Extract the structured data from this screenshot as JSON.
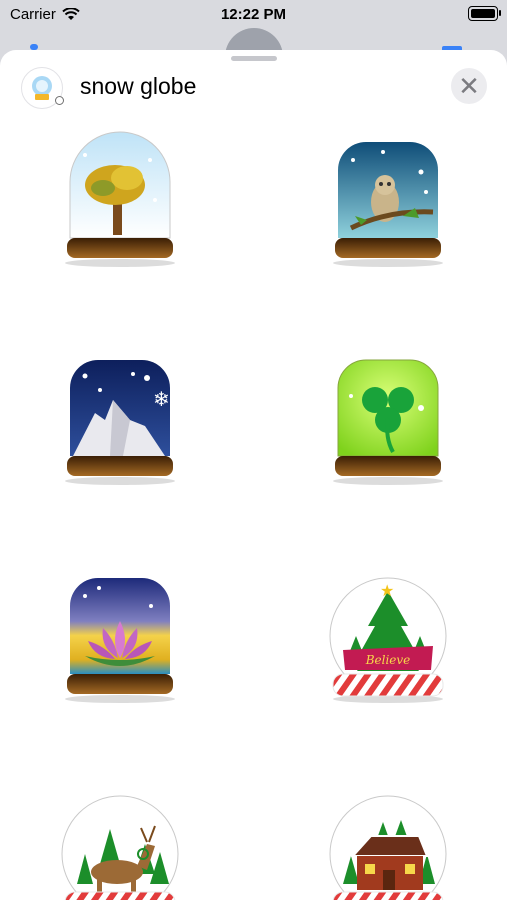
{
  "status_bar": {
    "carrier": "Carrier",
    "time": "12:22 PM"
  },
  "sheet": {
    "title": "snow globe"
  },
  "stickers": [
    {
      "name": "tree-snow-globe"
    },
    {
      "name": "owl-snow-globe"
    },
    {
      "name": "mountain-snow-globe"
    },
    {
      "name": "shamrock-snow-globe"
    },
    {
      "name": "lotus-snow-globe"
    },
    {
      "name": "christmas-tree-snow-globe",
      "banner_text": "Believe"
    },
    {
      "name": "reindeer-snow-globe"
    },
    {
      "name": "gingerbread-house-snow-globe"
    }
  ]
}
